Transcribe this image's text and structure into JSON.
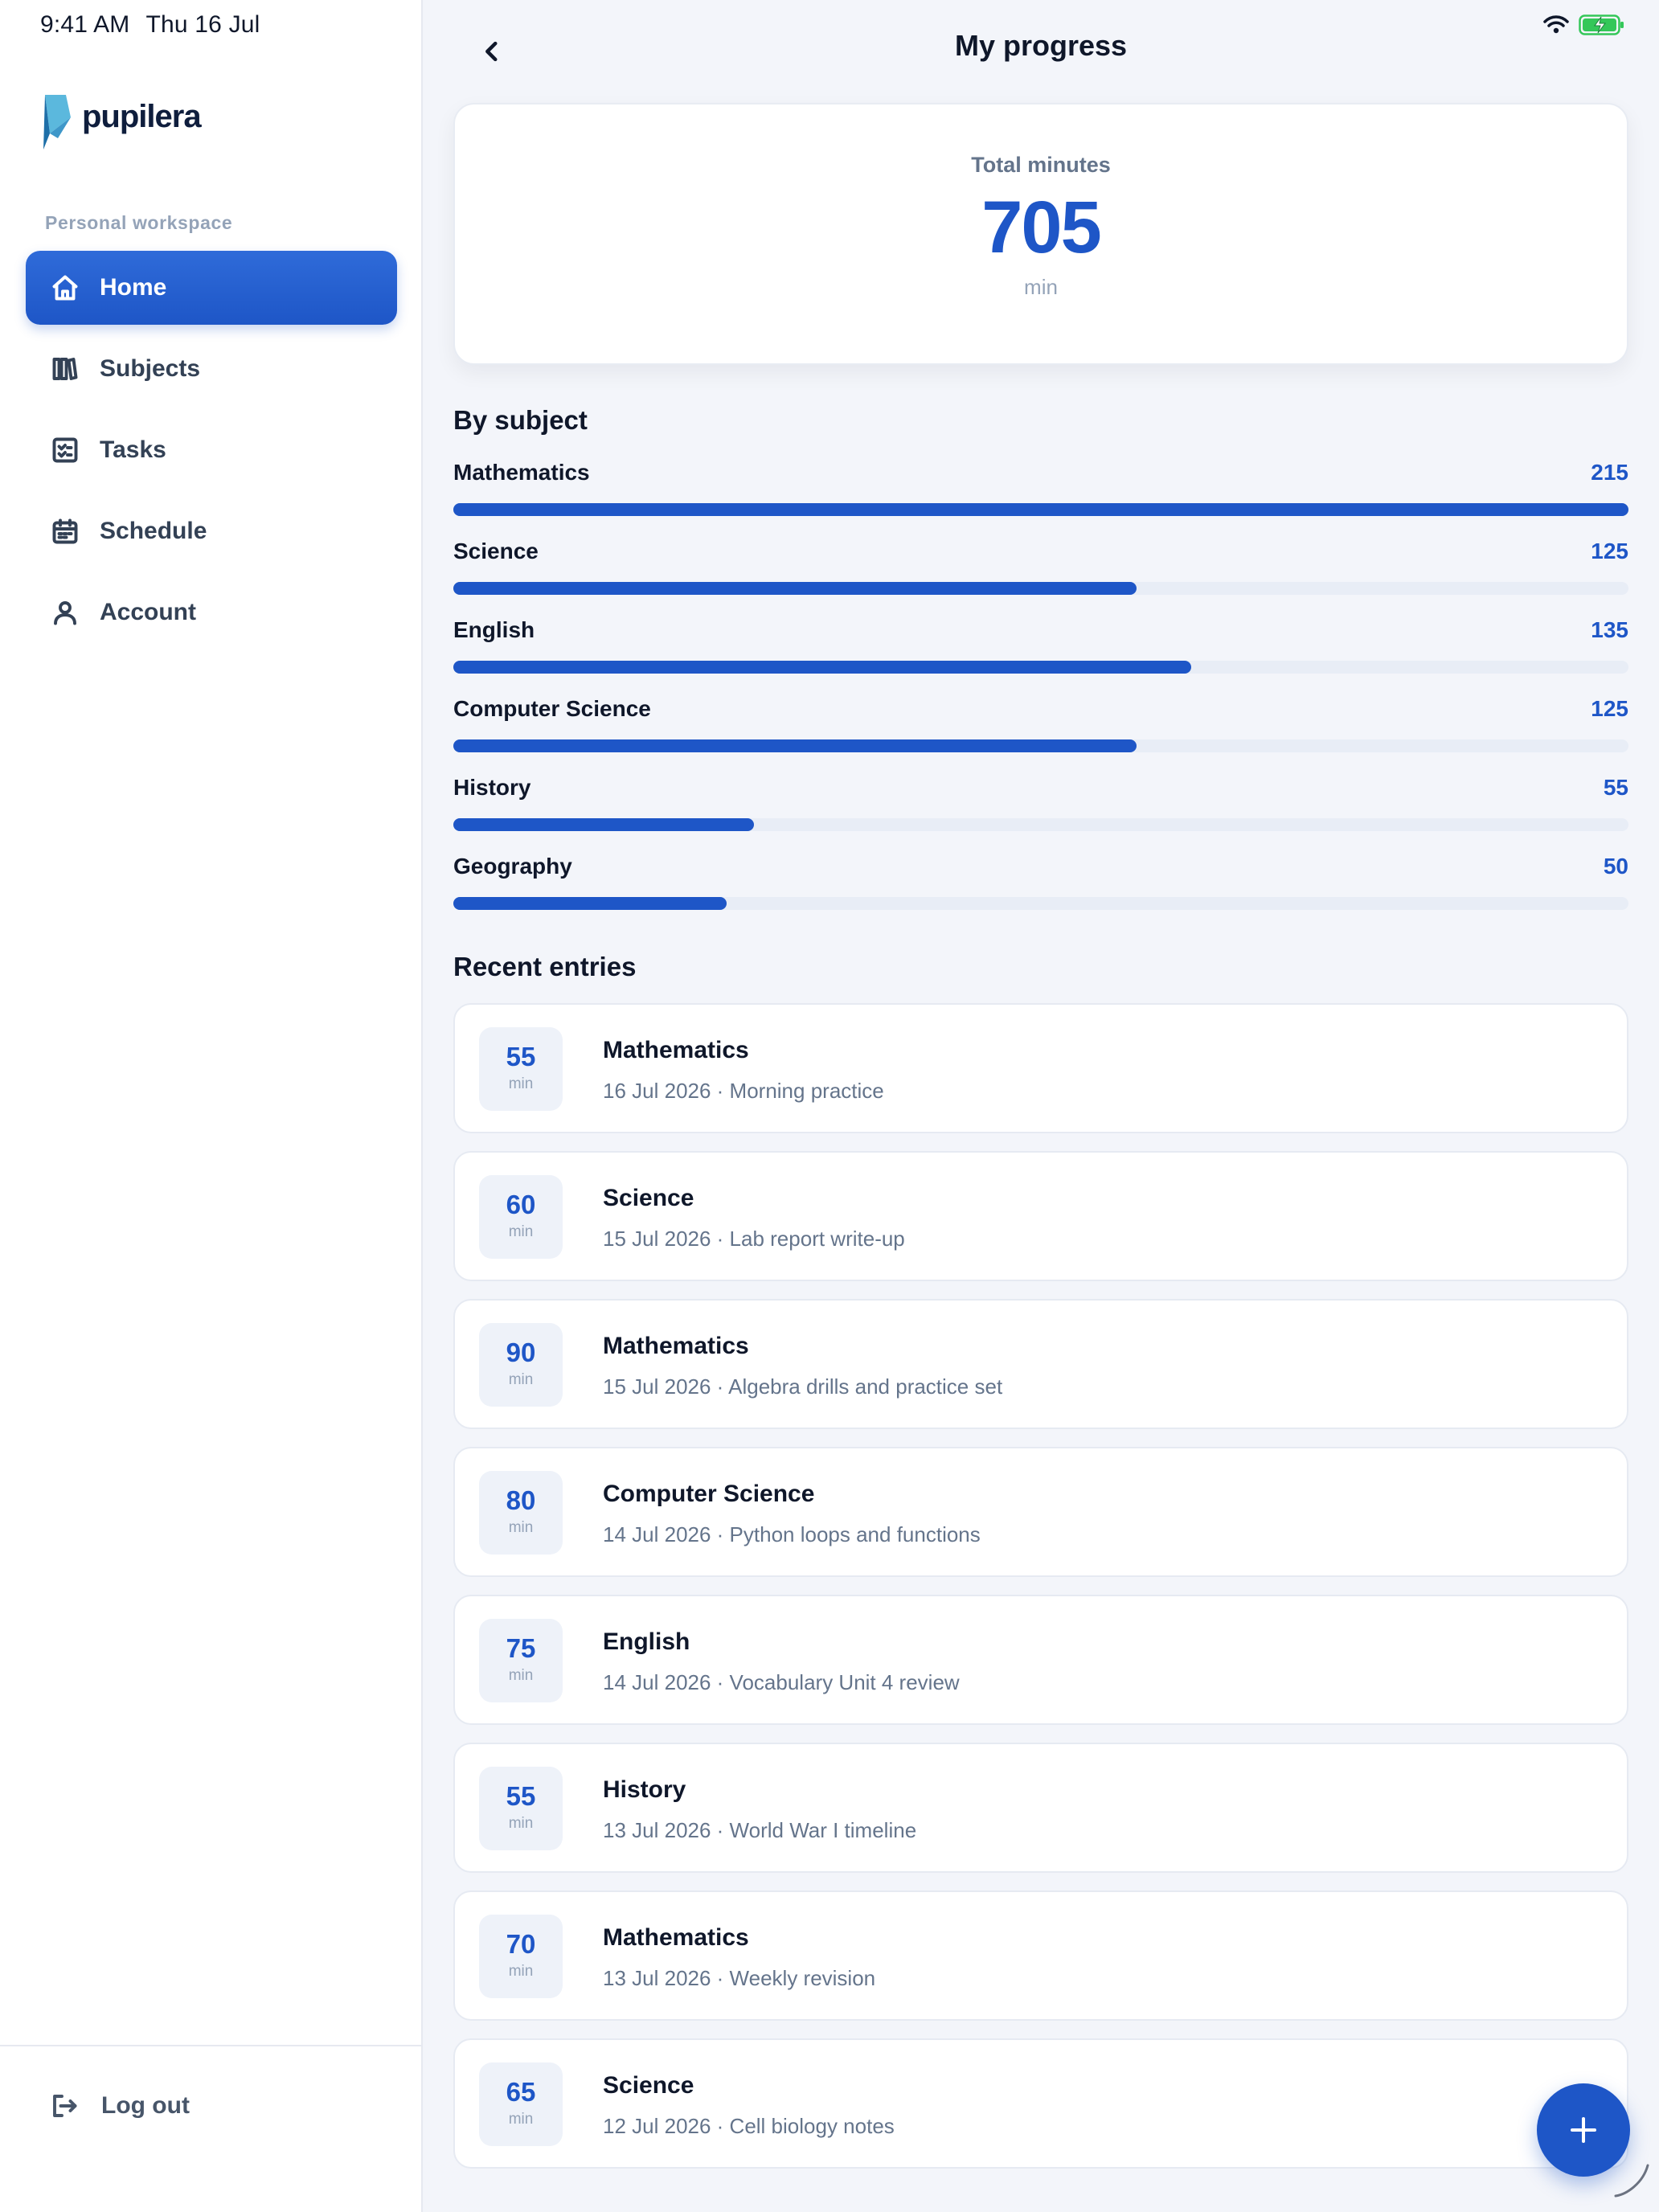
{
  "status_bar": {
    "time": "9:41 AM",
    "date": "Thu 16 Jul"
  },
  "brand": {
    "name": "pupilera",
    "accent_color": "#1e56c7"
  },
  "sidebar": {
    "section_label": "Personal workspace",
    "items": [
      {
        "label": "Home",
        "icon": "home-icon",
        "active": true
      },
      {
        "label": "Subjects",
        "icon": "books-icon",
        "active": false
      },
      {
        "label": "Tasks",
        "icon": "checklist-icon",
        "active": false
      },
      {
        "label": "Schedule",
        "icon": "calendar-icon",
        "active": false
      },
      {
        "label": "Account",
        "icon": "user-icon",
        "active": false
      }
    ],
    "logout_label": "Log out"
  },
  "header": {
    "title": "My progress"
  },
  "total": {
    "label": "Total minutes",
    "value": "705",
    "unit": "min"
  },
  "by_subject": {
    "title": "By subject",
    "max_value": 215,
    "rows": [
      {
        "name": "Mathematics",
        "value": 215
      },
      {
        "name": "Science",
        "value": 125
      },
      {
        "name": "English",
        "value": 135
      },
      {
        "name": "Computer Science",
        "value": 125
      },
      {
        "name": "History",
        "value": 55
      },
      {
        "name": "Geography",
        "value": 50
      }
    ]
  },
  "recent": {
    "title": "Recent entries",
    "unit": "min",
    "entries": [
      {
        "minutes": "55",
        "subject": "Mathematics",
        "meta": "16 Jul 2026 · Morning practice"
      },
      {
        "minutes": "60",
        "subject": "Science",
        "meta": "15 Jul 2026 · Lab report write-up"
      },
      {
        "minutes": "90",
        "subject": "Mathematics",
        "meta": "15 Jul 2026 · Algebra drills and practice set"
      },
      {
        "minutes": "80",
        "subject": "Computer Science",
        "meta": "14 Jul 2026 · Python loops and functions"
      },
      {
        "minutes": "75",
        "subject": "English",
        "meta": "14 Jul 2026 · Vocabulary Unit 4 review"
      },
      {
        "minutes": "55",
        "subject": "History",
        "meta": "13 Jul 2026 · World War I timeline"
      },
      {
        "minutes": "70",
        "subject": "Mathematics",
        "meta": "13 Jul 2026 · Weekly revision"
      },
      {
        "minutes": "65",
        "subject": "Science",
        "meta": "12 Jul 2026 · Cell biology notes"
      }
    ]
  },
  "fab": {
    "icon": "plus-icon"
  }
}
